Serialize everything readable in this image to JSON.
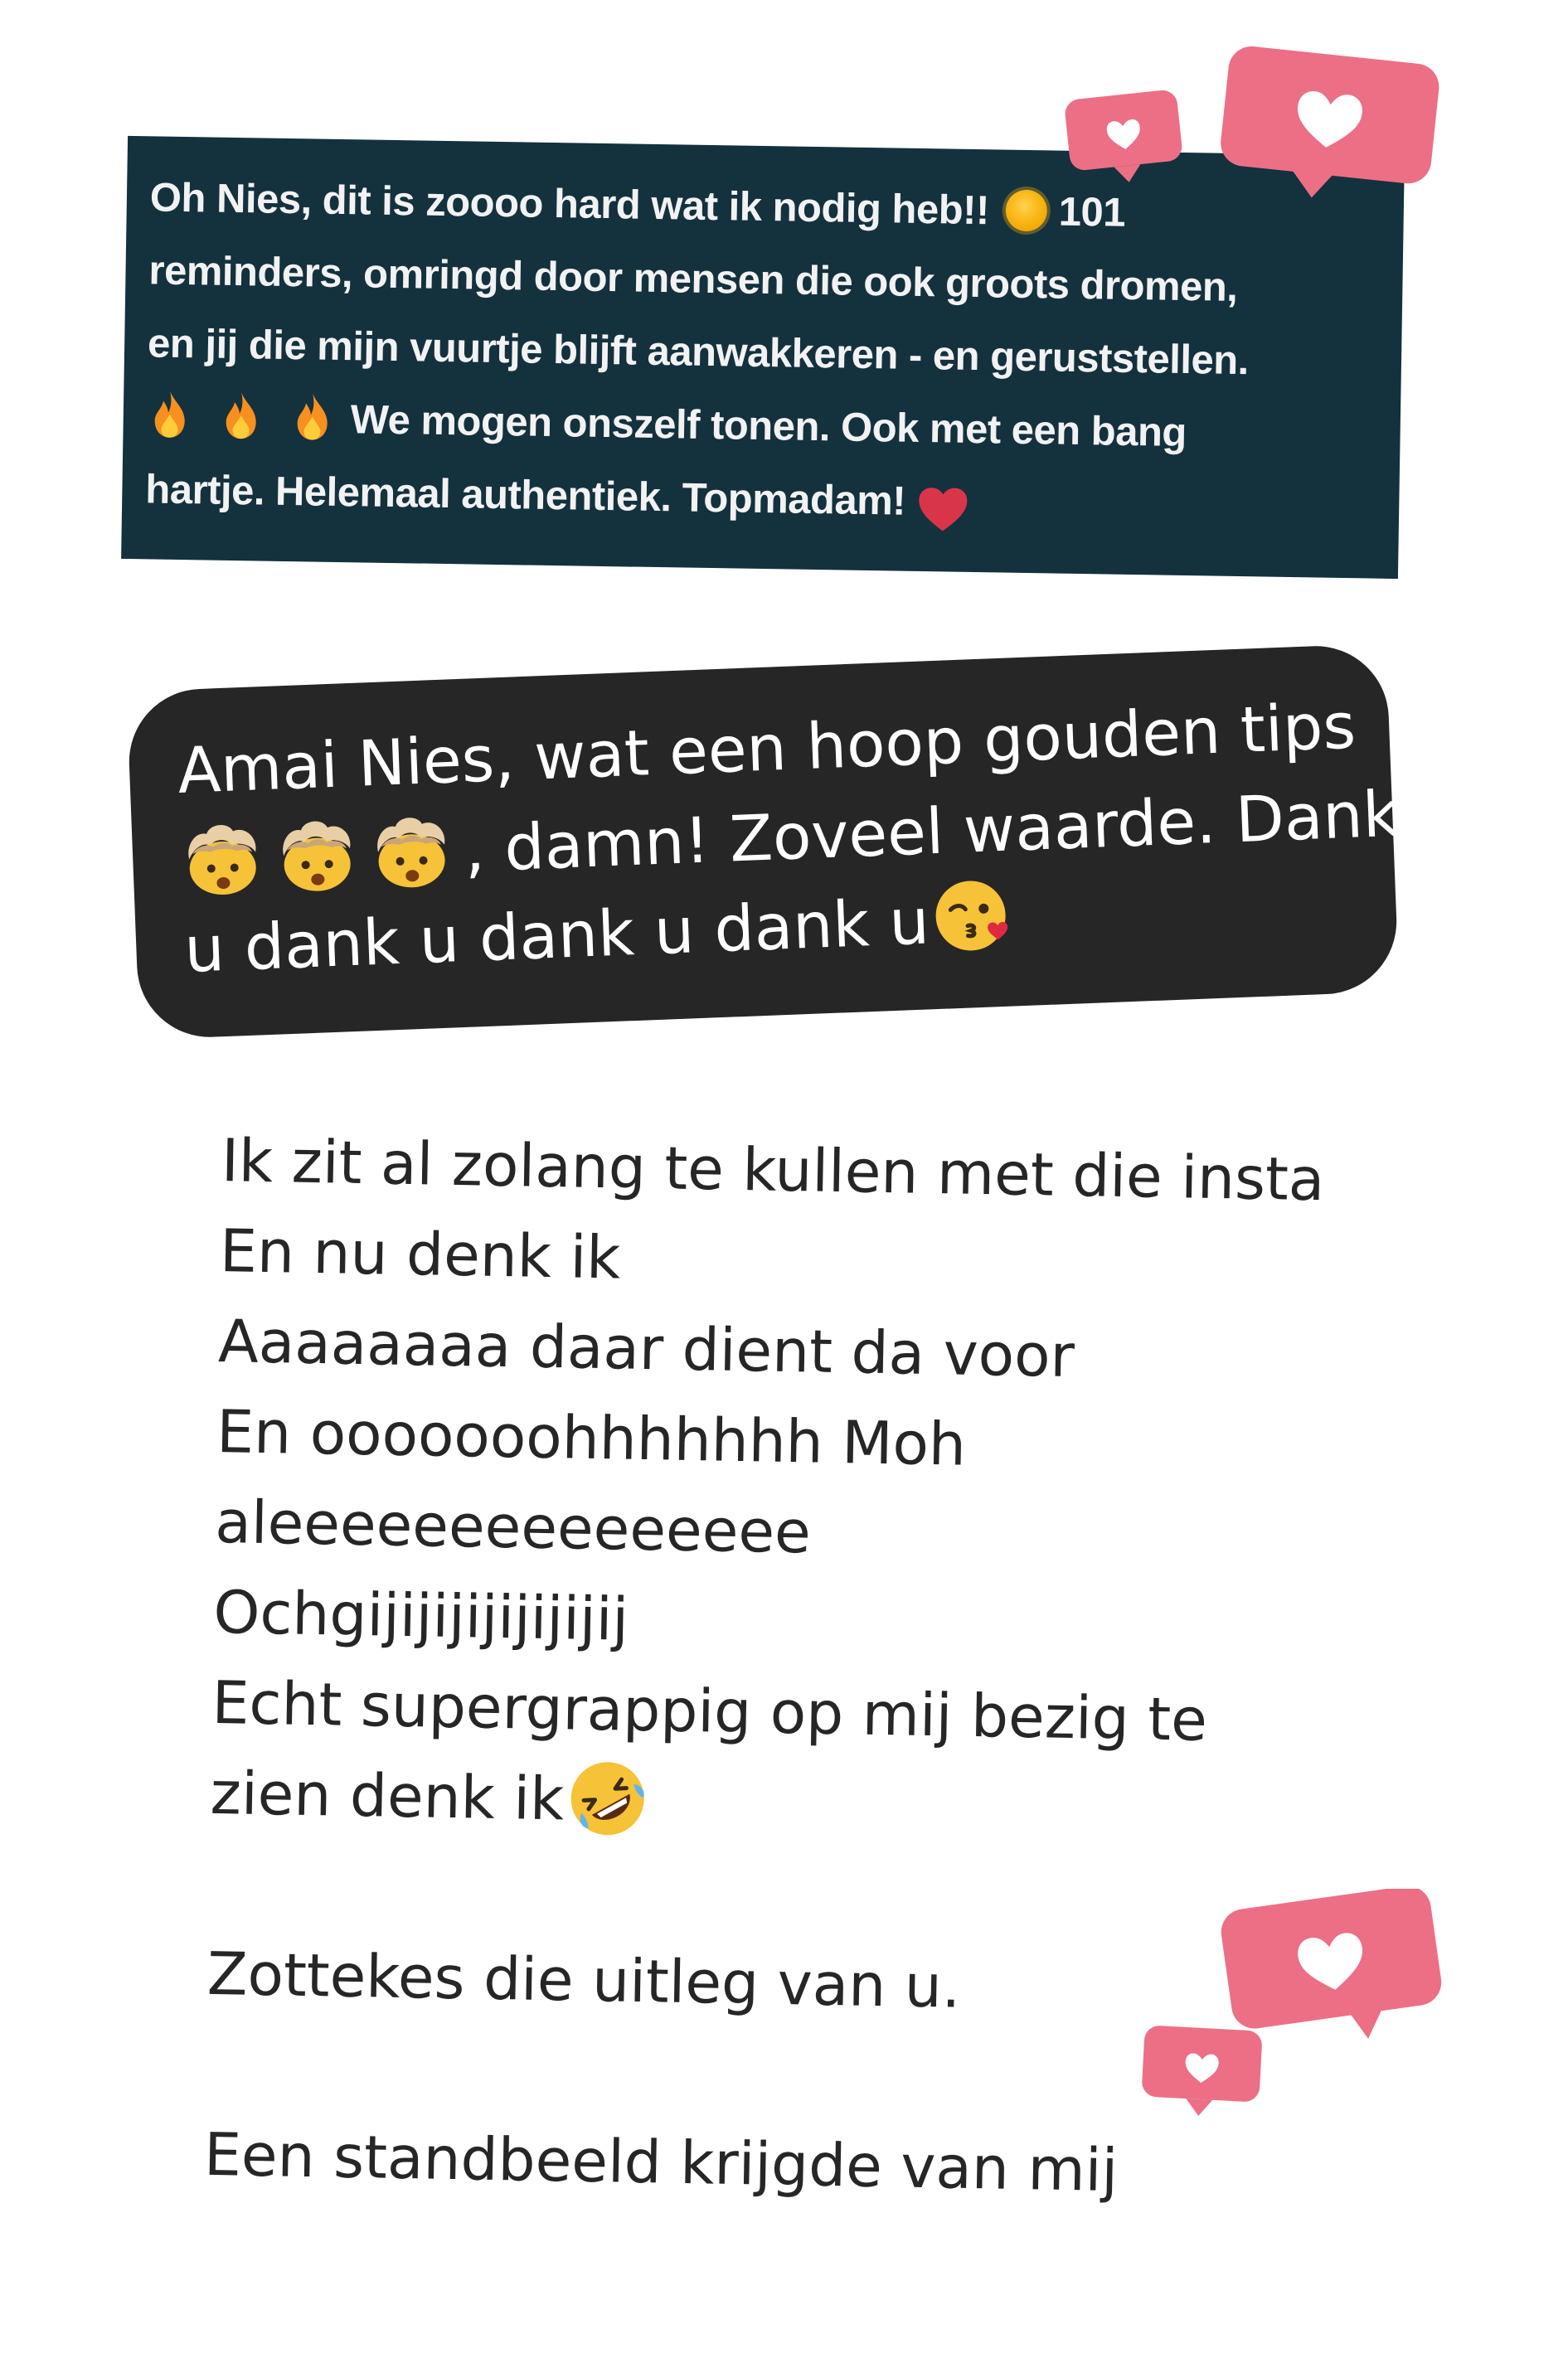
{
  "comment_card": {
    "line1_text": "Oh Nies, dit is zoooo hard wat ik nodig heb!!",
    "line1_end": "101",
    "line2": "reminders, omringd door mensen die ook groots dromen,",
    "line3": "en jij die mijn vuurtje blijft aanwakkeren - en geruststellen.",
    "line4": "We mogen onszelf tonen. Ook met een bang",
    "line5": "hartje. Helemaal authentiek. Topmadam!",
    "emojis": [
      "sun-emoji",
      "fire-emoji",
      "fire-emoji",
      "fire-emoji",
      "red-heart-emoji"
    ],
    "background": "#14313e"
  },
  "chat_bubble": {
    "line1": "Amai Nies, wat een hoop gouden tips",
    "line2": ", damn! Zoveel waarde. Dank",
    "line3": "u dank u dank u dank u",
    "emojis": [
      "exploding-head-emoji",
      "exploding-head-emoji",
      "exploding-head-emoji",
      "kissing-heart-emoji"
    ],
    "background": "#262626"
  },
  "message": {
    "lines": [
      "Ik zit al zolang te kullen met die insta",
      "En nu denk ik",
      "Aaaaaaaa daar dient da voor",
      "En  ooooooohhhhhhh Moh",
      "aleeeeeeeeeeeeeee",
      "Ochgijijijijijijijij",
      "Echt supergrappig op mij bezig te",
      "zien denk ik",
      "Zottekes die uitleg van u.",
      "Een standbeeld krijgde van mij"
    ],
    "emojis": [
      "rolling-laughing-emoji"
    ]
  },
  "colors": {
    "badge_pink": "#ec6f86",
    "text_dark": "#262626"
  }
}
